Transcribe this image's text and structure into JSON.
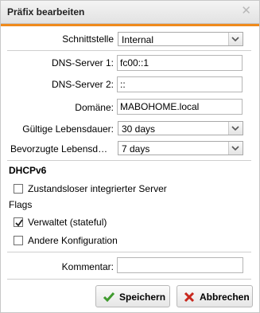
{
  "dialog": {
    "title": "Präfix bearbeiten"
  },
  "form": {
    "interface_label": "Schnittstelle",
    "interface_value": "Internal",
    "dns1_label": "DNS-Server 1:",
    "dns1_value": "fc00::1",
    "dns2_label": "DNS-Server 2:",
    "dns2_value": "::",
    "domain_label": "Domäne:",
    "domain_value": "MABOHOME.local",
    "valid_lifetime_label": "Gültige Lebensdauer:",
    "valid_lifetime_value": "30 days",
    "preferred_lifetime_label": "Bevorzugte Lebensd…",
    "preferred_lifetime_value": "7 days"
  },
  "dhcp": {
    "section_title": "DHCPv6",
    "stateless_label": "Zustandsloser integrierter Server",
    "stateless_checked": false
  },
  "flags": {
    "title": "Flags",
    "managed_label": "Verwaltet (stateful)",
    "managed_checked": true,
    "other_label": "Andere Konfiguration",
    "other_checked": false
  },
  "comment": {
    "label": "Kommentar:",
    "value": ""
  },
  "buttons": {
    "save_label": "Speichern",
    "cancel_label": "Abbrechen"
  },
  "colors": {
    "accent": "#ef8a1c",
    "save_icon": "#3f9a2e",
    "cancel_icon": "#c8281e"
  },
  "icons": {
    "close": "close-icon",
    "dropdown": "chevron-down-icon",
    "save": "checkmark-icon",
    "cancel": "x-icon"
  }
}
